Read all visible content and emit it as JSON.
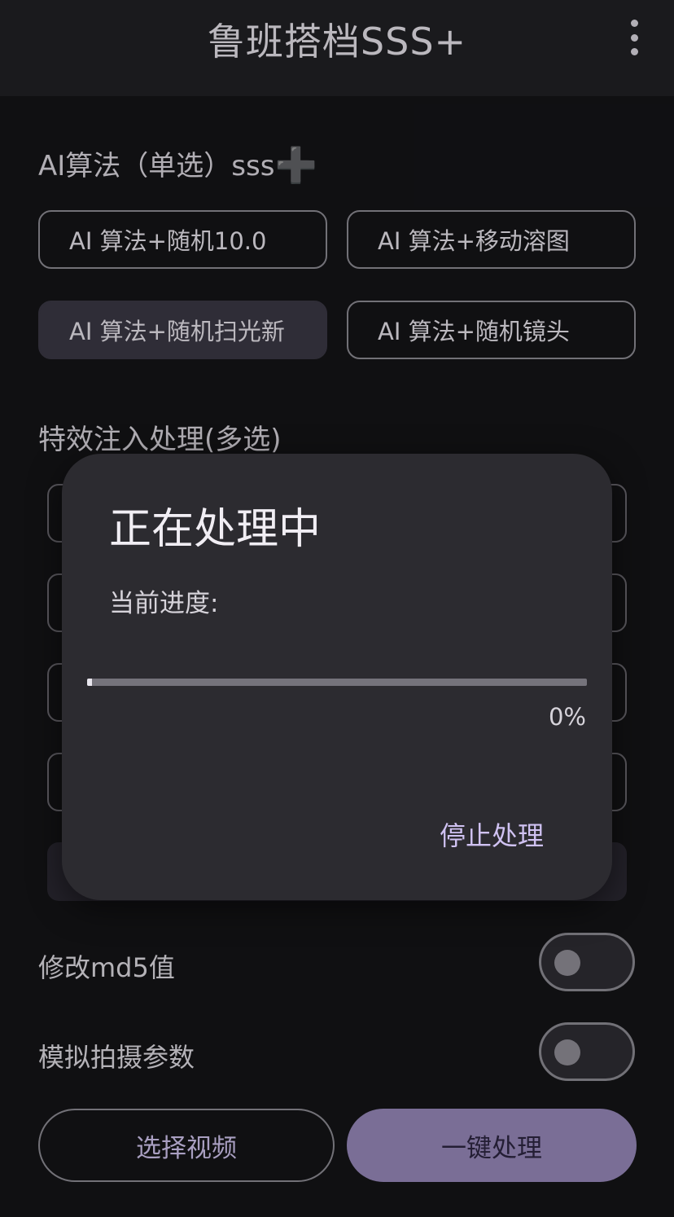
{
  "app": {
    "title": "鲁班搭档SSS+",
    "menu_icon": "more-vert-icon"
  },
  "algorithm_section": {
    "title": "AI算法（单选）sss",
    "plus_glyph": "➕",
    "options": [
      {
        "label": "AI 算法+随机10.0",
        "selected": false
      },
      {
        "label": "AI 算法+移动溶图",
        "selected": false
      },
      {
        "label": "AI 算法+随机扫光新",
        "selected": true
      },
      {
        "label": "AI 算法+随机镜头",
        "selected": false
      }
    ]
  },
  "effects_section": {
    "title": "特效注入处理(多选)"
  },
  "toggles": [
    {
      "label": "修改md5值",
      "on": false
    },
    {
      "label": "模拟拍摄参数",
      "on": false
    }
  ],
  "actions": {
    "select_video": "选择视频",
    "process_all": "一键处理"
  },
  "dialog": {
    "title": "正在处理中",
    "progress_label": "当前进度:",
    "progress_value": 0,
    "progress_text": "0%",
    "stop_label": "停止处理"
  },
  "colors": {
    "accent": "#9587b8",
    "accent_text": "#d0c2f2",
    "surface": "#2c2b30",
    "background": "#141417"
  }
}
